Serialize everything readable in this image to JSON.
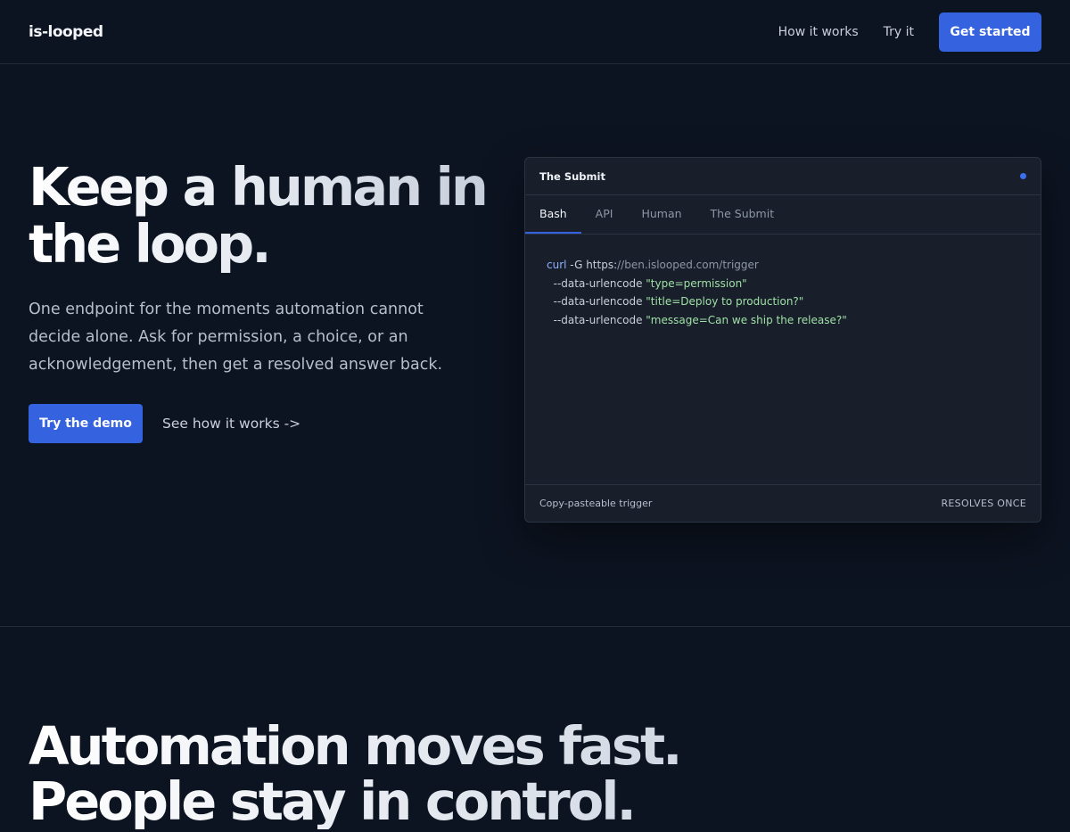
{
  "header": {
    "logo": "is-looped",
    "nav": [
      "How it works",
      "Try it"
    ],
    "cta": "Get started"
  },
  "hero": {
    "title_line1": "Keep a human in",
    "title_line2": "the loop.",
    "subtitle": "One endpoint for the moments automation cannot decide alone. Ask for permission, a choice, or an acknowledgement, then get a resolved answer back.",
    "primary_button": "Try the demo",
    "secondary_link": "See how it works ->"
  },
  "card": {
    "title": "The Submit",
    "status_color": "#3b6ff0",
    "tabs": [
      "Bash",
      "API",
      "Human",
      "The Submit"
    ],
    "active_tab": "Bash",
    "code": {
      "l1_cmd": "curl",
      "l1_flag": " -G ",
      "l1_url_a": "https:",
      "l1_url_b": "//ben.islooped.com/trigger",
      "flag": "  --data-urlencode ",
      "l2_str": "\"type=permission\"",
      "l3_str": "\"title=Deploy to production?\"",
      "l4_str": "\"message=Can we ship the release?\""
    },
    "footer_left": "Copy-pasteable trigger",
    "footer_right": "RESOLVES ONCE"
  },
  "section2": {
    "title_line1": "Automation moves fast.",
    "title_line2": "People stay in control."
  },
  "colors": {
    "background": "#0d1421",
    "accent": "#3563e0",
    "code_string": "#9fe0a6",
    "code_keyword": "#8fb0ff"
  }
}
